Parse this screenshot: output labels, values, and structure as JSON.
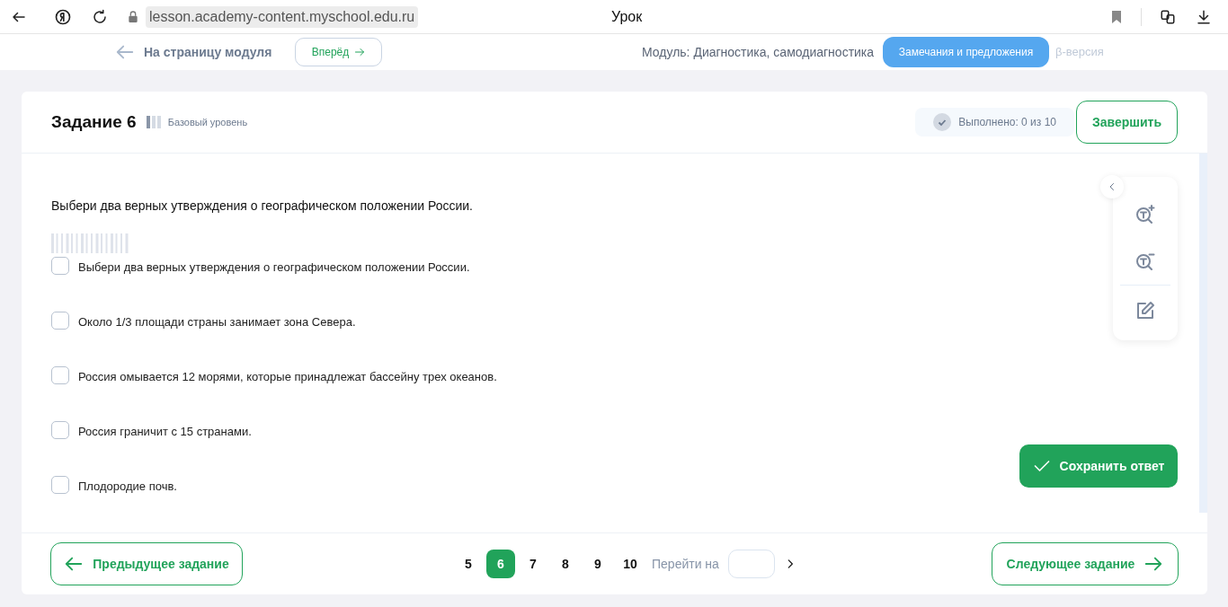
{
  "browser": {
    "url": "lesson.academy-content.myschool.edu.ru",
    "title": "Урок"
  },
  "topbar": {
    "back_link": "На страницу модуля",
    "forward_button": "Вперёд",
    "module": "Модуль: Диагностика, самодиагностика",
    "feedback_button": "Замечания и предложения",
    "beta": "β-версия"
  },
  "task": {
    "title": "Задание 6",
    "level": "Базовый уровень",
    "progress": "Выполнено: 0 из 10",
    "finish_button": "Завершить"
  },
  "question": "Выбери два верных утверждения о географическом положении России.",
  "options": [
    {
      "label": "Выбери два верных утверждения о географическом положении России.",
      "checked": false
    },
    {
      "label": "Около 1/3 площади страны занимает зона Севера.",
      "checked": false
    },
    {
      "label": "Россия омывается 12 морями, которые принадлежат бассейну трех океанов.",
      "checked": false
    },
    {
      "label": "Россия граничит с 15 странами.",
      "checked": false
    },
    {
      "label": "Плодородие почв.",
      "checked": false
    }
  ],
  "save_button": "Сохранить ответ",
  "footer": {
    "prev_button": "Предыдущее задание",
    "pages": [
      {
        "label": "5",
        "selected": false
      },
      {
        "label": "6",
        "selected": true
      },
      {
        "label": "7",
        "selected": false
      },
      {
        "label": "8",
        "selected": false
      },
      {
        "label": "9",
        "selected": false
      },
      {
        "label": "10",
        "selected": false
      }
    ],
    "goto_label": "Перейти на",
    "next_button": "Следующее задание"
  }
}
